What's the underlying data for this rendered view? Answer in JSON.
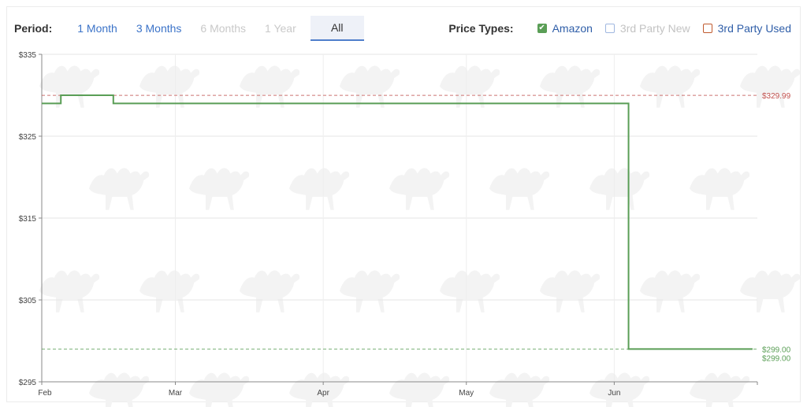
{
  "toolbar": {
    "period_label": "Period:",
    "periods": [
      {
        "label": "1 Month",
        "state": "enabled"
      },
      {
        "label": "3 Months",
        "state": "enabled"
      },
      {
        "label": "6 Months",
        "state": "disabled"
      },
      {
        "label": "1 Year",
        "state": "disabled"
      },
      {
        "label": "All",
        "state": "active"
      }
    ],
    "price_types_label": "Price Types:",
    "price_types": [
      {
        "label": "Amazon",
        "checked": true,
        "color": "#5a9e56",
        "disabled": false
      },
      {
        "label": "3rd Party New",
        "checked": false,
        "color": "#9fb7e0",
        "disabled": true
      },
      {
        "label": "3rd Party Used",
        "checked": false,
        "color": "#c05a2e",
        "disabled": false
      }
    ]
  },
  "chart_data": {
    "type": "line",
    "xlabel": "",
    "ylabel": "",
    "x_ticks": [
      "Feb",
      "Mar",
      "Apr",
      "May",
      "Jun"
    ],
    "y_ticks": [
      "$295",
      "$305",
      "$315",
      "$325",
      "$335"
    ],
    "ylim": [
      295,
      335
    ],
    "grid": true,
    "series": [
      {
        "name": "Amazon",
        "color": "#5a9e56",
        "step": true,
        "points": [
          [
            "2023-02-01",
            329.0
          ],
          [
            "2023-02-05",
            330.0
          ],
          [
            "2023-02-16",
            329.0
          ],
          [
            "2023-06-04",
            299.0
          ],
          [
            "2023-06-30",
            299.0
          ]
        ]
      }
    ],
    "reference_lines": [
      {
        "value": 329.99,
        "label": "$329.99",
        "color": "#c0504d",
        "style": "dashed"
      },
      {
        "value": 299.0,
        "label": "$299.00",
        "color": "#5a9e56",
        "style": "dashed"
      }
    ],
    "current_value_label": {
      "value": 299.0,
      "label": "$299.00",
      "color": "#5a9e56"
    }
  }
}
